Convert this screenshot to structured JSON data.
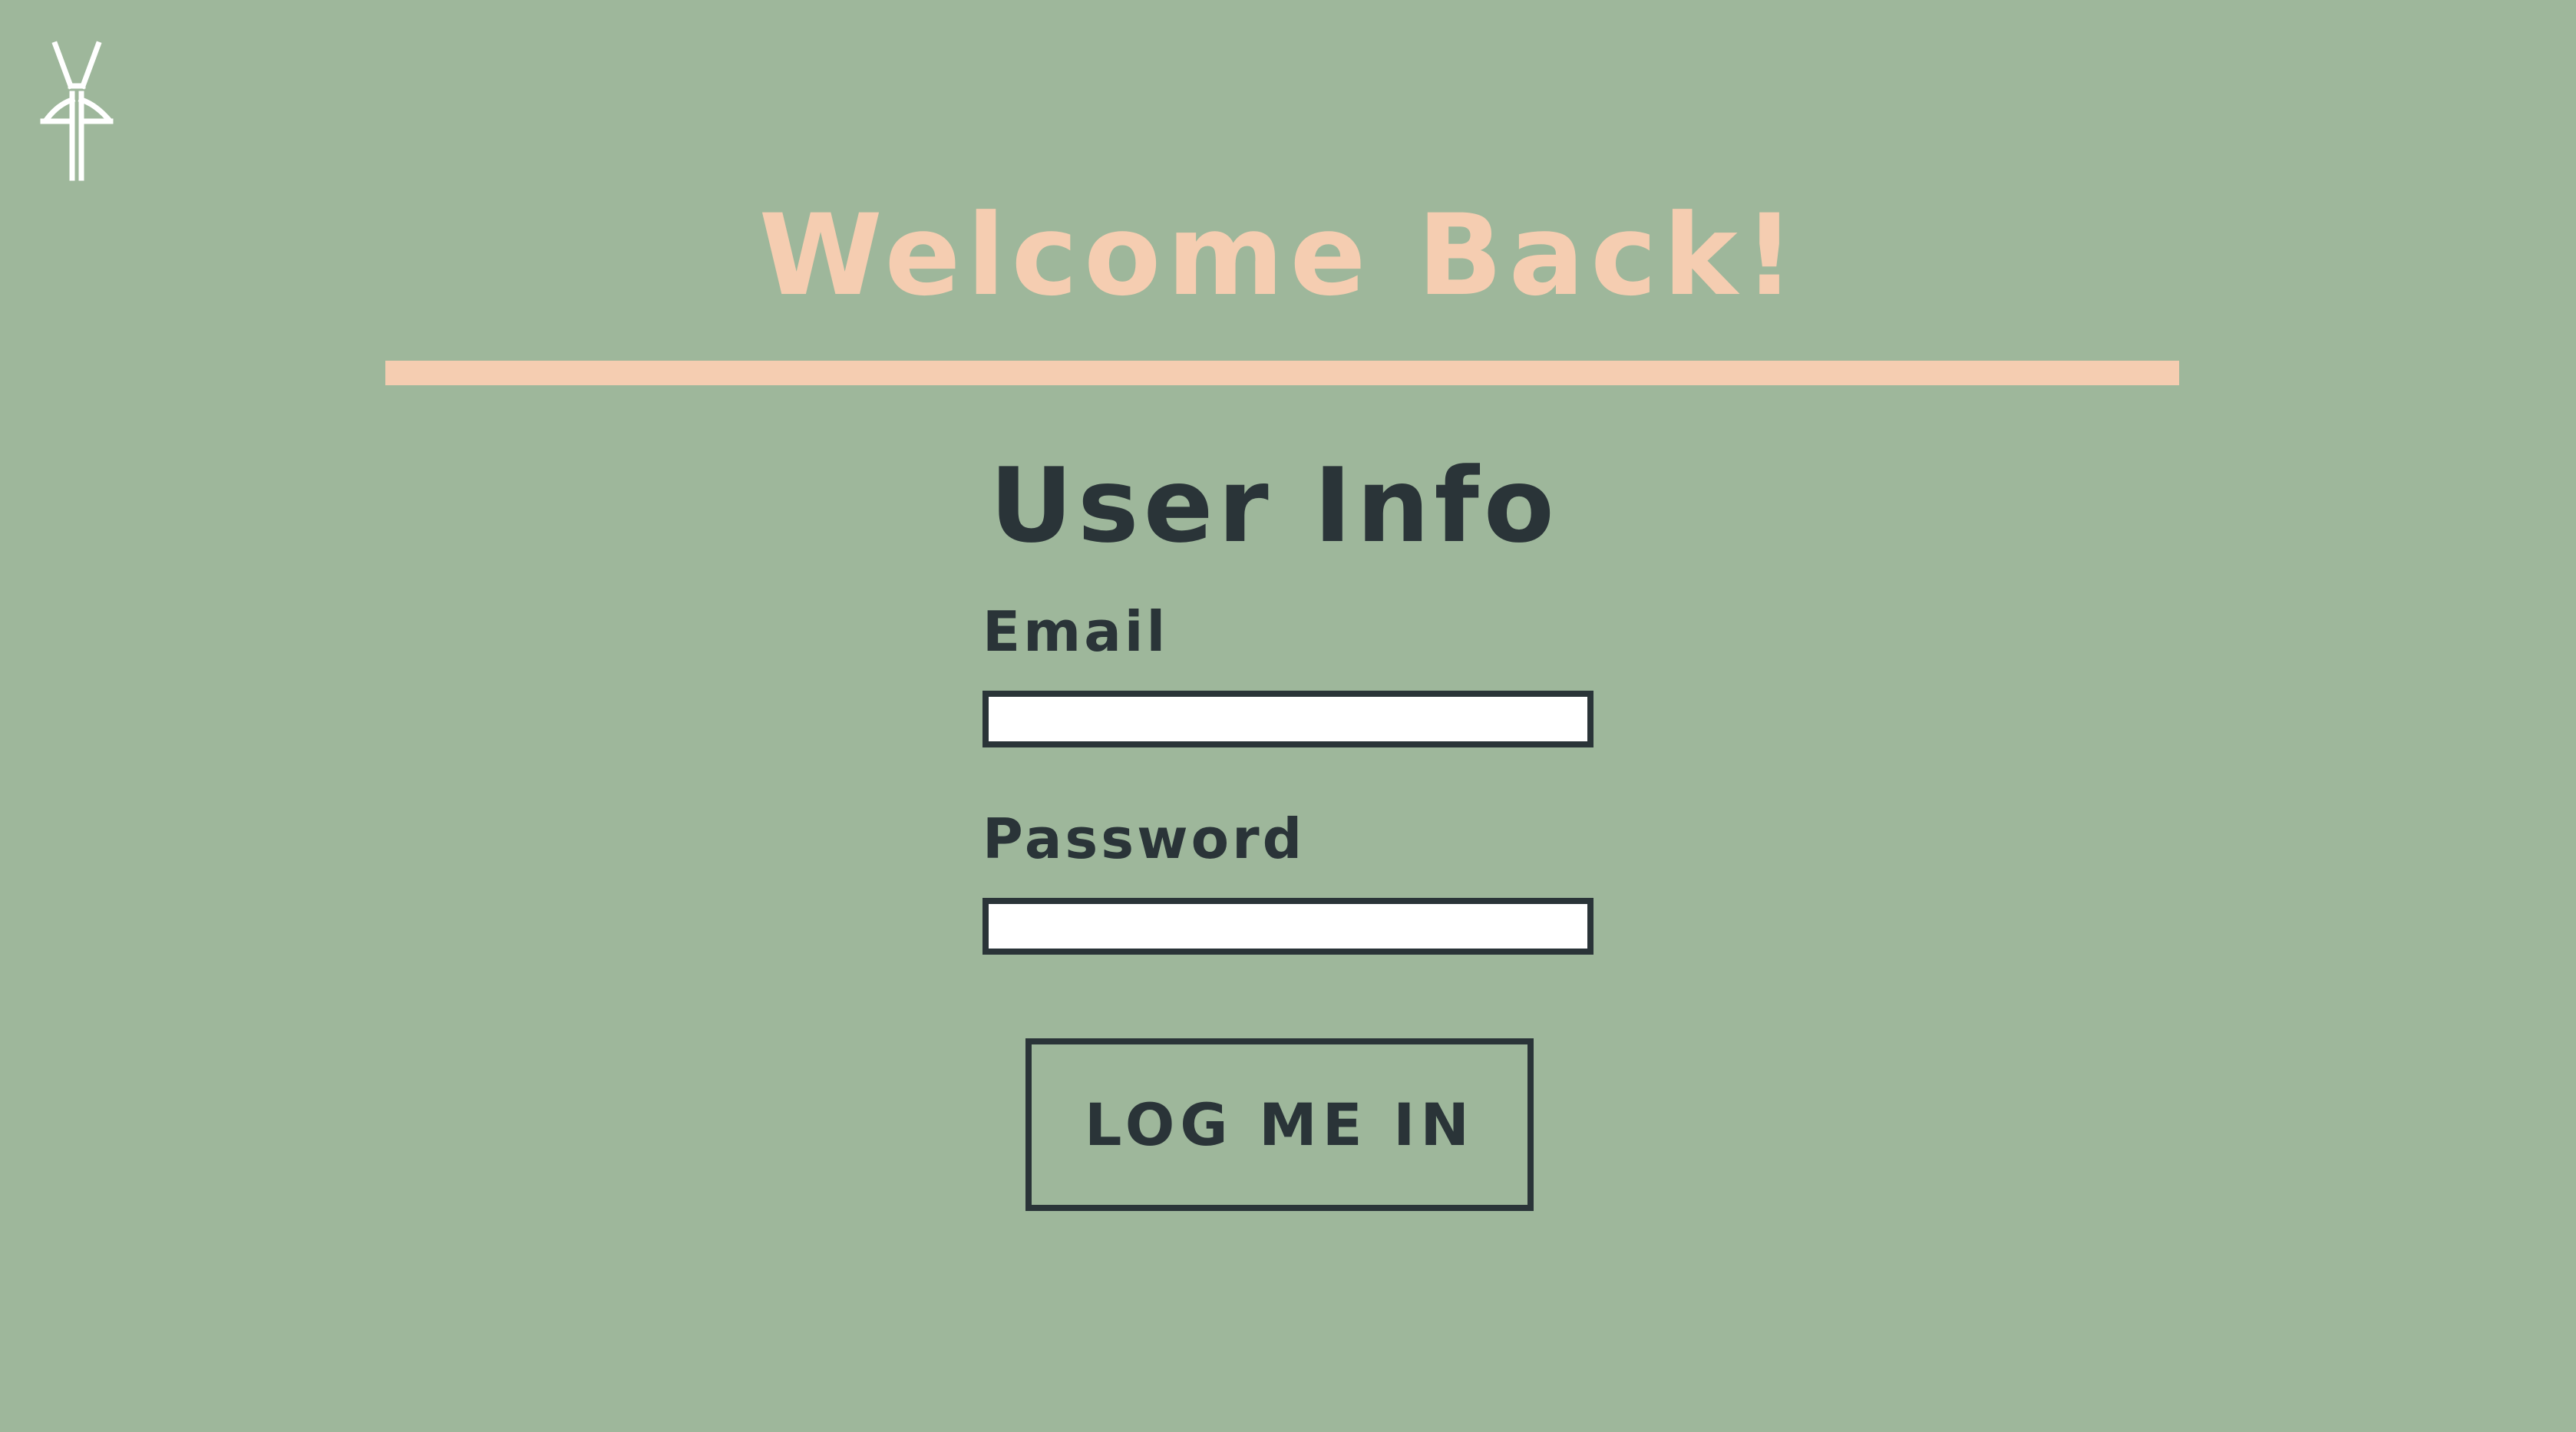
{
  "logo": {
    "icon": "stylized-tree-logo-icon",
    "color": "#ffffff"
  },
  "header": {
    "title": "Welcome Back!"
  },
  "form": {
    "section_title": "User Info",
    "email_label": "Email",
    "email_value": "",
    "password_label": "Password",
    "password_value": "",
    "submit_label": "LOG ME IN"
  },
  "colors": {
    "background": "#9eb79b",
    "accent": "#f5cdb1",
    "text": "#2a3438",
    "input_background": "#ffffff"
  }
}
